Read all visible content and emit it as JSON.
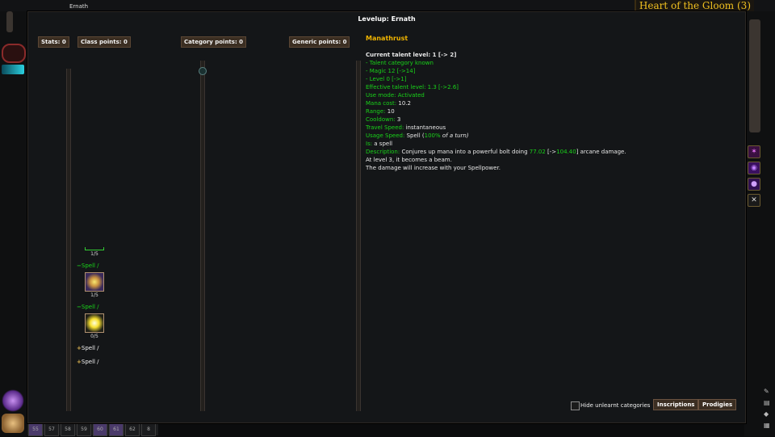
{
  "window": {
    "character_name": "Ernath",
    "zone_title": "Heart of the Gloom (3)"
  },
  "dialog": {
    "title": "Levelup: Ernath",
    "stats_label": "Stats: 0",
    "class_points_label": "Class points: 0",
    "category_points_label": "Category points: 0",
    "generic_points_label": "Generic points: 0"
  },
  "talent_list": {
    "items": [
      {
        "count": "1/5"
      },
      {
        "prefix": "−",
        "label": "Spell /",
        "count": "1/5",
        "icon": "manathrust-icon"
      },
      {
        "prefix": "−",
        "label": "Spell /",
        "count": "0/5",
        "icon": "flame-burst-icon"
      },
      {
        "prefix": "+",
        "label": "Spell /"
      },
      {
        "prefix": "+",
        "label": "Spell /"
      }
    ]
  },
  "talent_info": {
    "name": "Manathrust",
    "current_level": "Current talent level: 1 [-> 2]",
    "req_category": "- Talent category known",
    "req_magic": "- Magic 12 [->14]",
    "req_level": "- Level 0 [->1]",
    "effective_level": "Effective talent level: 1.3 [->2.6]",
    "use_mode_label": "Use mode: ",
    "use_mode_value": "Activated",
    "mana_cost_label": "Mana cost: ",
    "mana_cost_value": "10.2",
    "range_label": "Range: ",
    "range_value": "10",
    "cooldown_label": "Cooldown: ",
    "cooldown_value": "3",
    "travel_label": "Travel Speed: ",
    "travel_value": "instantaneous",
    "usage_label": "Usage Speed: ",
    "usage_value": "Spell (",
    "usage_pct": "100%",
    "usage_tail": " of a turn)",
    "is_label": "Is: ",
    "is_value": "a spell",
    "desc_label": "Description: ",
    "desc_text": "Conjures up mana into a powerful bolt doing ",
    "desc_value": "77.02",
    "desc_arrow": " [->",
    "desc_value2": "104.40",
    "desc_tail": "] arcane damage.",
    "desc_line2": "At level 3, it becomes a beam.",
    "desc_line3": "The damage will increase with your Spellpower."
  },
  "footer": {
    "hide_unlearnt_label": "Hide unlearnt categories",
    "inscriptions_label": "Inscriptions",
    "prodigies_label": "Prodigies"
  },
  "hotbar": {
    "keys": [
      "55",
      "57",
      "58",
      "59",
      "60",
      "61",
      "62",
      "8"
    ]
  },
  "colors": {
    "accent_gold": "#f0b400",
    "value_green": "#19d319",
    "panel": "#141618",
    "chip": "#3b2e22"
  }
}
